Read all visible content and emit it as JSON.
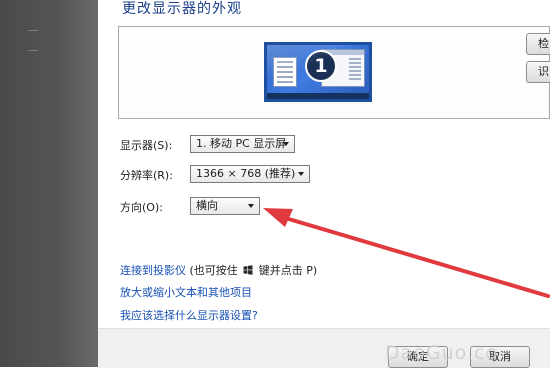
{
  "dialog": {
    "title": "更改显示器的外观"
  },
  "preview": {
    "monitor_number": "1",
    "side_buttons": [
      "检",
      "识"
    ]
  },
  "settings": {
    "display": {
      "label": "显示器(S):",
      "value": "1. 移动 PC 显示屏"
    },
    "resolution": {
      "label": "分辨率(R):",
      "value": "1366 × 768 (推荐)"
    },
    "orientation": {
      "label": "方向(O):",
      "value": "横向"
    }
  },
  "links": {
    "projector": {
      "link_text": "连接到投影仪",
      "hint_before": " (也可按住 ",
      "hint_after": " 键并点击 P)"
    },
    "text_size": "放大或缩小文本和其他项目",
    "which_settings": "我应该选择什么显示器设置?"
  },
  "footer": {
    "ok_label": "确定",
    "cancel_label": "取消"
  },
  "watermark": {
    "text": "DaoGuo.co"
  },
  "colors": {
    "annotation_arrow": "#e0393e",
    "link": "#1751b5",
    "title": "#1c3f8b"
  }
}
